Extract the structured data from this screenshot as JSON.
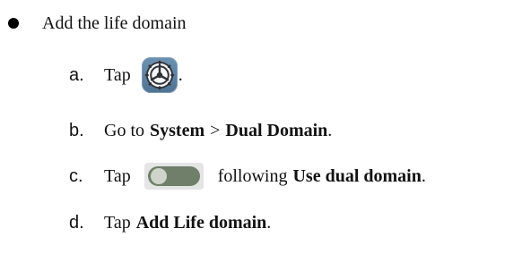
{
  "bullet": {
    "title": "Add the life domain"
  },
  "steps": [
    {
      "letter": "a.",
      "text_before": "Tap",
      "icon": "gear-icon",
      "text_after": "."
    },
    {
      "letter": "b.",
      "text_before": "Go to",
      "bold_1": "System",
      "separator": ">",
      "bold_2": "Dual Domain",
      "text_after": "."
    },
    {
      "letter": "c.",
      "text_before": "Tap",
      "icon": "toggle-switch-icon",
      "text_middle": "following",
      "bold_1": "Use dual domain",
      "text_after": "."
    },
    {
      "letter": "d.",
      "text_before": "Tap",
      "bold_1": "Add Life domain",
      "text_after": "."
    }
  ],
  "colors": {
    "gear_background": "#5f82a1",
    "toggle_track": "#6f7f69",
    "toggle_knob": "#cfd4cb",
    "text": "#111111"
  }
}
